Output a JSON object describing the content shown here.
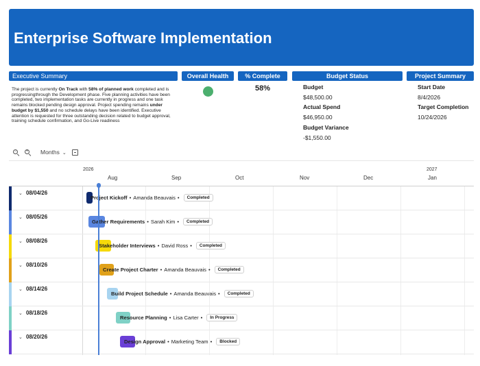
{
  "header": {
    "title": "Enterprise Software Implementation"
  },
  "panels": {
    "executive_summary": {
      "title": "Executive Summary",
      "text_parts": [
        {
          "t": "The project is currently ",
          "b": false
        },
        {
          "t": "On Track",
          "b": true
        },
        {
          "t": " with ",
          "b": false
        },
        {
          "t": "58% of planned work",
          "b": true
        },
        {
          "t": " completed and is progressingthrough the Development phase. Five planning activities have been completed, two implementation tasks are currently in progress and one task remains blocked pending design approval. Project spending remains ",
          "b": false
        },
        {
          "t": "under budget by $1,550",
          "b": true
        },
        {
          "t": " and no schedule delays have been identified. Executive attention is requested for three outstanding decision related to budget approval, training schedule confirmation, and Go-Live readiness",
          "b": false
        }
      ]
    },
    "overall_health": {
      "title": "Overall Health",
      "color": "#4caf6e"
    },
    "percent_complete": {
      "title": "% Complete",
      "value": "58%"
    },
    "budget_status": {
      "title": "Budget Status",
      "budget_label": "Budget",
      "budget_value": "$48,500.00",
      "actual_label": "Actual Spend",
      "actual_value": "$46,950.00",
      "variance_label": "Budget Variance",
      "variance_value": "-$1,550.00"
    },
    "project_summary": {
      "title": "Project Summary",
      "start_label": "Start Date",
      "start_value": "8/4/2026",
      "target_label": "Target Completion",
      "target_value": "10/24/2026"
    }
  },
  "toolbar": {
    "zoom_in_icon": "zoom-in-icon",
    "zoom_out_icon": "zoom-out-icon",
    "scale_label": "Months",
    "export_icon": "export-icon"
  },
  "timeline": {
    "years": [
      "2026",
      "2027"
    ],
    "months": [
      "Aug",
      "Sep",
      "Oct",
      "Nov",
      "Dec",
      "Jan"
    ]
  },
  "tasks": [
    {
      "date": "08/04/26",
      "name": "Project Kickoff",
      "owner": "Amanda Beauvais",
      "status": "Completed",
      "color": "#0f2a6e"
    },
    {
      "date": "08/05/26",
      "name": "Gather Requirements",
      "owner": "Sarah Kim",
      "status": "Completed",
      "color": "#5a86e0"
    },
    {
      "date": "08/08/26",
      "name": "Stakeholder Interviews",
      "owner": "David Ross",
      "status": "Completed",
      "color": "#f5d90a"
    },
    {
      "date": "08/10/26",
      "name": "Create Project Charter",
      "owner": "Amanda Beauvais",
      "status": "Completed",
      "color": "#e0a11a"
    },
    {
      "date": "08/14/26",
      "name": "Build Project Schedule",
      "owner": "Amanda Beauvais",
      "status": "Completed",
      "color": "#a8d4f0"
    },
    {
      "date": "08/18/26",
      "name": "Resource Planning",
      "owner": "Lisa Carter",
      "status": "In Progress",
      "color": "#7fd1c6"
    },
    {
      "date": "08/20/26",
      "name": "Design Approval",
      "owner": "Marketing Team",
      "status": "Blocked",
      "color": "#6a3fd6"
    }
  ]
}
